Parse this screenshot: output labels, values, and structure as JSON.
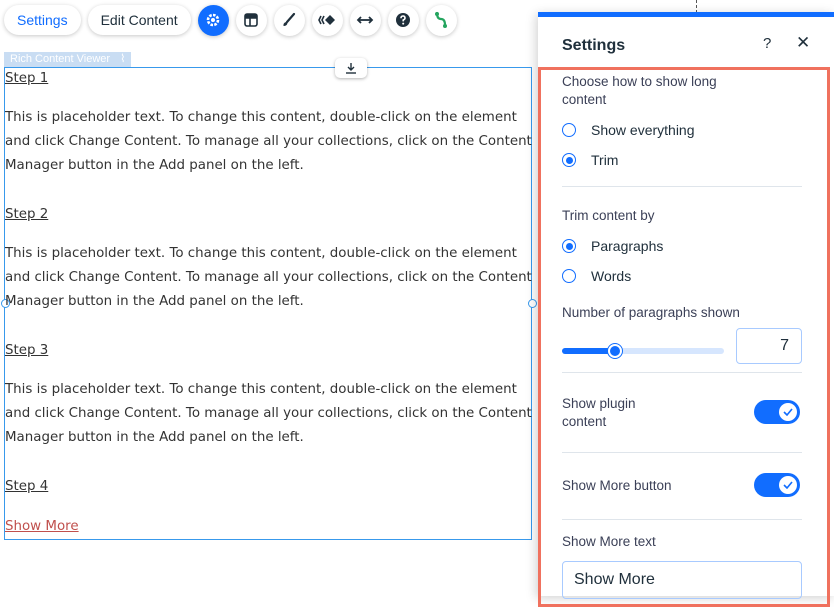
{
  "toolbar": {
    "settings_label": "Settings",
    "edit_content_label": "Edit Content",
    "icons": [
      "gear-icon",
      "layout-icon",
      "brush-icon",
      "animation-icon",
      "stretch-icon",
      "help-icon",
      "connect-icon"
    ]
  },
  "canvas": {
    "element_tag": "Rich Content Viewer",
    "steps": [
      {
        "title": "Step 1",
        "text": "This is placeholder text. To change this content, double-click on the element and click Change Content. To manage all your collections, click on the Content Manager button in the Add panel on the left."
      },
      {
        "title": "Step 2",
        "text": "This is placeholder text. To change this content, double-click on the element and click Change Content. To manage all your collections, click on the Content Manager button in the Add panel on the left."
      },
      {
        "title": "Step 3",
        "text": "This is placeholder text. To change this content, double-click on the element and click Change Content. To manage all your collections, click on the Content Manager button in the Add panel on the left."
      },
      {
        "title": "Step 4"
      }
    ],
    "show_more_link": "Show More"
  },
  "panel": {
    "title": "Settings",
    "help_symbol": "?",
    "close_symbol": "✕",
    "long_content_label": "Choose how to show long content",
    "long_content_options": [
      "Show everything",
      "Trim"
    ],
    "long_content_selected": "Trim",
    "trim_by_label": "Trim content by",
    "trim_by_options": [
      "Paragraphs",
      "Words"
    ],
    "trim_by_selected": "Paragraphs",
    "paragraphs_label": "Number of paragraphs shown",
    "paragraphs_value": "7",
    "slider_fraction": 0.33,
    "plugin_content_label": "Show plugin content",
    "plugin_content_on": true,
    "show_more_button_label": "Show More button",
    "show_more_button_on": true,
    "show_more_text_label": "Show More text",
    "show_more_text_value": "Show More"
  },
  "colors": {
    "accent": "#116dff",
    "highlight_box": "#f0715e",
    "selection": "#3899ec",
    "link": "#c0504d"
  }
}
